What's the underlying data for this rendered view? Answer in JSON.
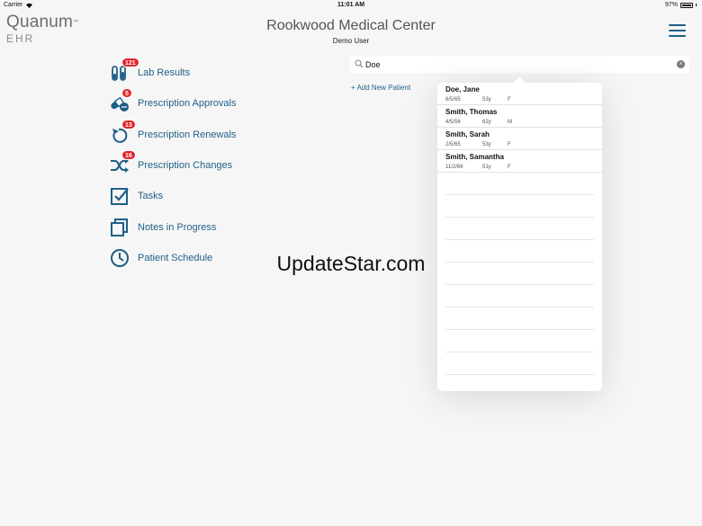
{
  "status_bar": {
    "carrier": "Carrier",
    "time": "11:01 AM",
    "battery": "97%",
    "battery_level": 0.97
  },
  "logo": {
    "name": "Quanum",
    "trademark": "™",
    "product": "EHR"
  },
  "header": {
    "title": "Rookwood Medical Center",
    "user": "Demo User"
  },
  "nav": {
    "items": [
      {
        "label": "Lab Results",
        "icon": "test-tubes-icon",
        "badge": "121"
      },
      {
        "label": "Prescription Approvals",
        "icon": "pills-icon",
        "badge": "5"
      },
      {
        "label": "Prescription Renewals",
        "icon": "renew-icon",
        "badge": "13"
      },
      {
        "label": "Prescription Changes",
        "icon": "shuffle-icon",
        "badge": "16"
      },
      {
        "label": "Tasks",
        "icon": "checkbox-icon",
        "badge": ""
      },
      {
        "label": "Notes in Progress",
        "icon": "notes-icon",
        "badge": ""
      },
      {
        "label": "Patient Schedule",
        "icon": "clock-icon",
        "badge": ""
      }
    ]
  },
  "search": {
    "value": "Doe",
    "clear": "×"
  },
  "add_patient": "+ Add New Patient",
  "results": [
    {
      "name": "Doe, Jane",
      "dob": "6/5/65",
      "age": "53y",
      "sex": "F"
    },
    {
      "name": "Smith, Thomas",
      "dob": "4/5/56",
      "age": "62y",
      "sex": "M"
    },
    {
      "name": "Smith, Sarah",
      "dob": "2/5/65",
      "age": "53y",
      "sex": "F"
    },
    {
      "name": "Smith, Samantha",
      "dob": "11/2/66",
      "age": "51y",
      "sex": "F"
    }
  ],
  "watermark": "UpdateStar.com",
  "colors": {
    "accent": "#1f5f87",
    "badge": "#e0262b"
  }
}
